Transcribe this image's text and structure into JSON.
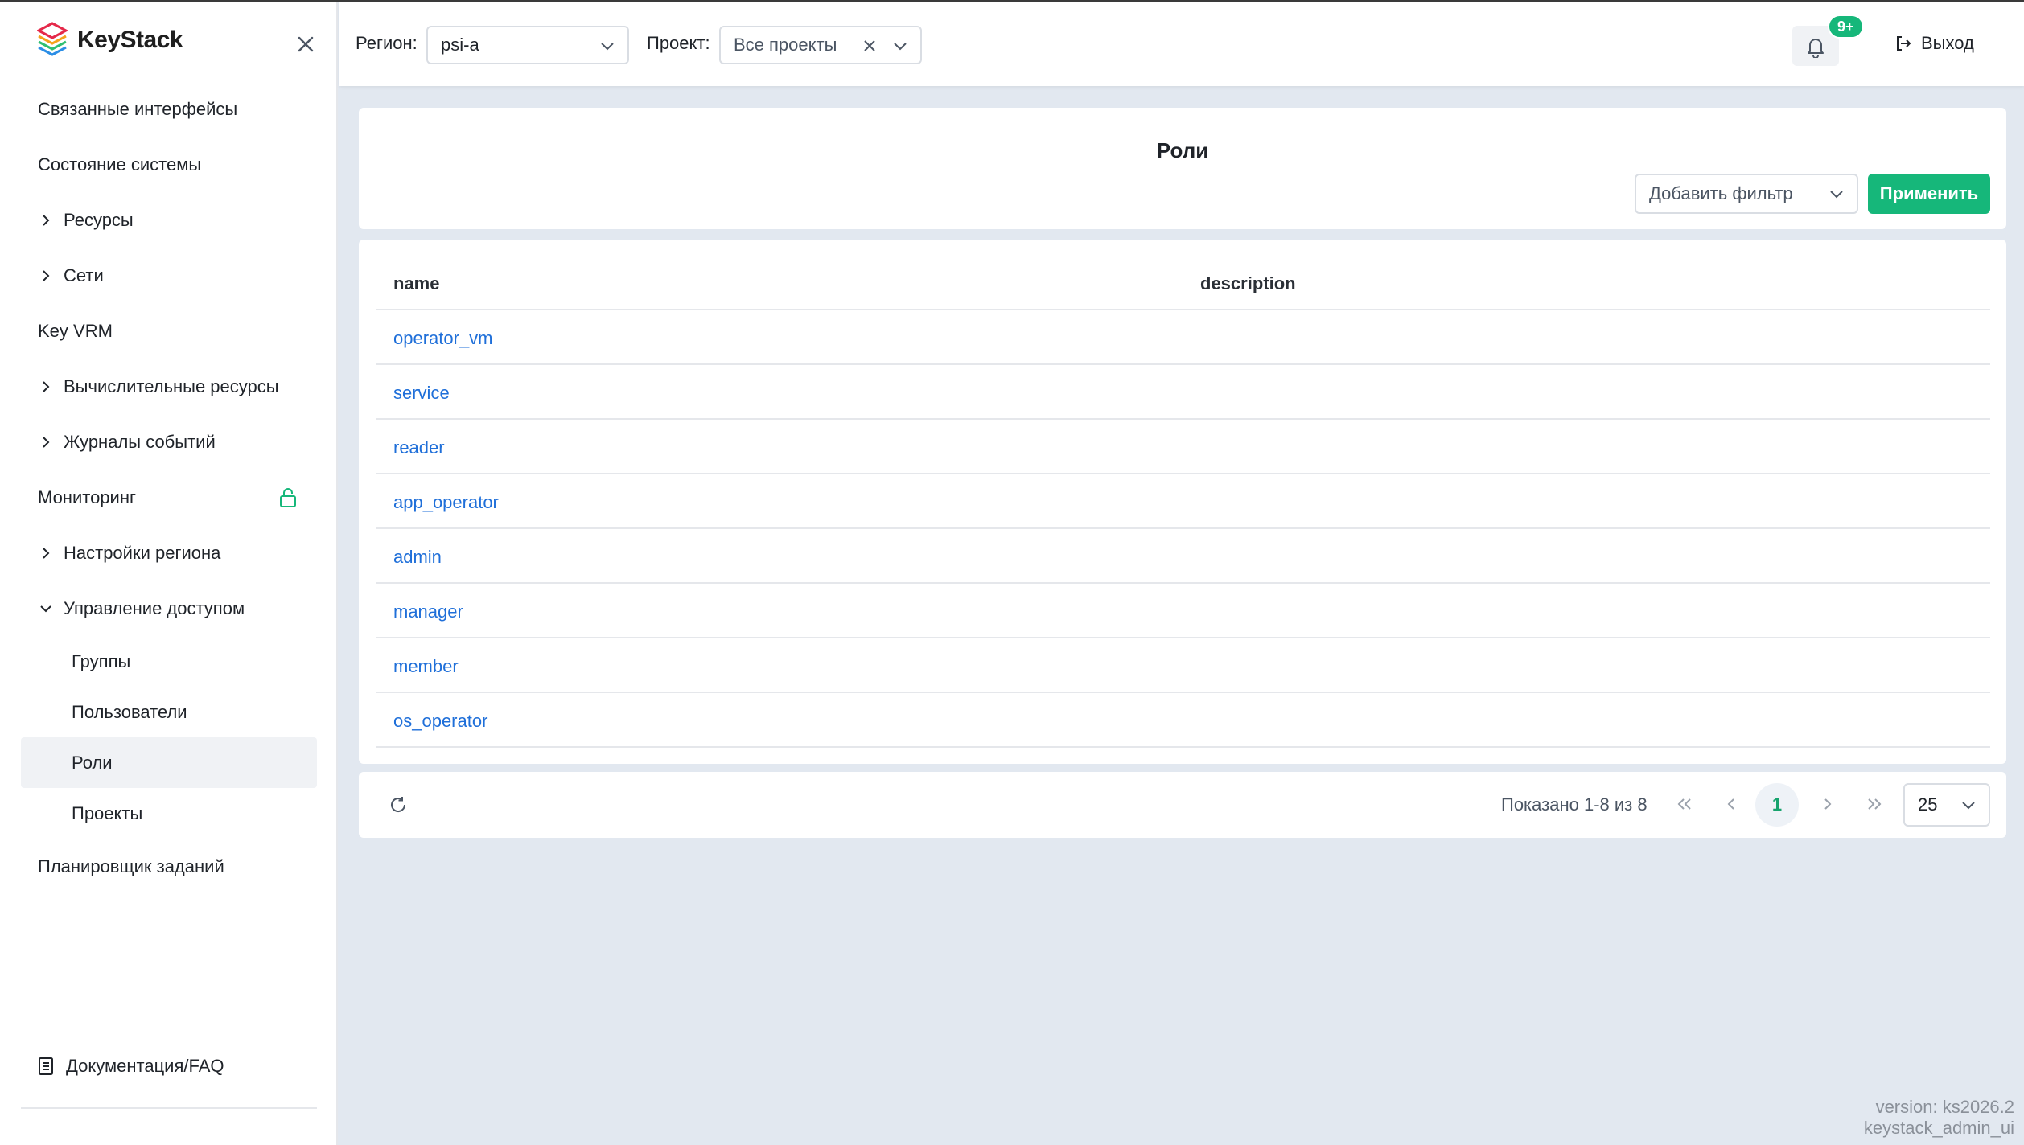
{
  "app": {
    "name": "KeyStack"
  },
  "sidebar": {
    "items": [
      {
        "label": "Связанные интерфейсы",
        "expandable": false
      },
      {
        "label": "Состояние системы",
        "expandable": false
      },
      {
        "label": "Ресурсы",
        "expandable": true
      },
      {
        "label": "Сети",
        "expandable": true
      },
      {
        "label": "Key VRM",
        "expandable": false
      },
      {
        "label": "Вычислительные ресурсы",
        "expandable": true
      },
      {
        "label": "Журналы событий",
        "expandable": true
      },
      {
        "label": "Мониторинг",
        "expandable": false,
        "locked": true
      },
      {
        "label": "Настройки региона",
        "expandable": true
      },
      {
        "label": "Управление доступом",
        "expandable": true,
        "expanded": true
      }
    ],
    "access_subitems": [
      {
        "label": "Группы"
      },
      {
        "label": "Пользователи"
      },
      {
        "label": "Роли",
        "active": true
      },
      {
        "label": "Проекты"
      }
    ],
    "scheduler": "Планировщик заданий",
    "docs": "Документация/FAQ"
  },
  "header": {
    "region_label": "Регион:",
    "region_value": "psi-a",
    "project_label": "Проект:",
    "project_value": "Все проекты",
    "notifications_badge": "9+",
    "logout": "Выход"
  },
  "page": {
    "title": "Роли",
    "filter_placeholder": "Добавить фильтр",
    "apply": "Применить"
  },
  "table": {
    "columns": [
      "name",
      "description"
    ],
    "rows": [
      {
        "name": "operator_vm",
        "description": ""
      },
      {
        "name": "service",
        "description": ""
      },
      {
        "name": "reader",
        "description": ""
      },
      {
        "name": "app_operator",
        "description": ""
      },
      {
        "name": "admin",
        "description": ""
      },
      {
        "name": "manager",
        "description": ""
      },
      {
        "name": "member",
        "description": ""
      },
      {
        "name": "os_operator",
        "description": ""
      }
    ]
  },
  "pagination": {
    "shown": "Показано 1-8 из 8",
    "current_page": "1",
    "page_size": "25"
  },
  "version": {
    "line1": "version: ks2026.2",
    "line2": "keystack_admin_ui"
  },
  "colors": {
    "accent": "#16b77a",
    "link": "#1f6fd9"
  }
}
